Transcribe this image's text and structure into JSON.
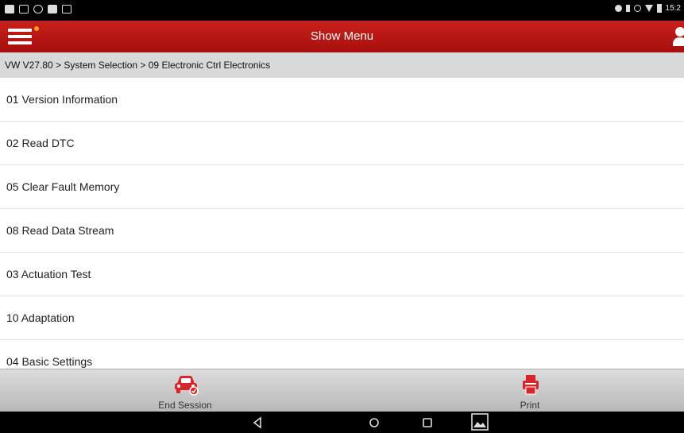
{
  "status_bar": {
    "time": "15:2",
    "left_icons": [
      "notification-icon",
      "screenshot-icon",
      "usb-icon",
      "notification-icon",
      "debug-icon"
    ],
    "right_icons": [
      "location-icon",
      "bluetooth-icon",
      "alarm-icon",
      "wifi-icon",
      "battery-icon"
    ]
  },
  "header": {
    "title": "Show Menu",
    "accent_color": "#b8151a"
  },
  "breadcrumb": {
    "text": "VW V27.80 > System Selection > 09 Electronic Ctrl Electronics"
  },
  "menu": {
    "items": [
      {
        "label": "01 Version Information"
      },
      {
        "label": "02 Read DTC"
      },
      {
        "label": "05 Clear Fault Memory"
      },
      {
        "label": "08 Read Data Stream"
      },
      {
        "label": "03 Actuation Test"
      },
      {
        "label": "10 Adaptation"
      },
      {
        "label": "04 Basic Settings"
      }
    ]
  },
  "toolbar": {
    "end_session_label": "End Session",
    "print_label": "Print",
    "icon_color": "#d7262b"
  },
  "nav": {
    "buttons": [
      "back-icon",
      "home-icon",
      "recents-icon",
      "gallery-icon"
    ]
  }
}
